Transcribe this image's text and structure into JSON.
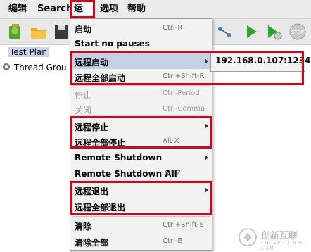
{
  "menubar": {
    "items": [
      "编辑",
      "Search",
      "运行",
      "选项",
      "帮助"
    ],
    "active": "运行"
  },
  "tree": {
    "test_plan": "Test Plan",
    "thread_group": "Thread Grou"
  },
  "run_menu": {
    "items": [
      {
        "label": "启动",
        "shortcut": "Ctrl-R"
      },
      {
        "label": "Start no pauses",
        "shortcut": ""
      },
      {
        "label": "远程启动",
        "shortcut": ""
      },
      {
        "label": "远程全部启动",
        "shortcut": "Ctrl+Shift-R"
      },
      {
        "label": "停止",
        "shortcut": "Ctrl-Period"
      },
      {
        "label": "关闭",
        "shortcut": "Ctrl-Comma"
      },
      {
        "label": "远程停止",
        "shortcut": ""
      },
      {
        "label": "远程全部停止",
        "shortcut": "Alt-X"
      },
      {
        "label": "Remote Shutdown",
        "shortcut": ""
      },
      {
        "label": "Remote Shutdown All",
        "shortcut": "Alt-Z"
      },
      {
        "label": "远程退出",
        "shortcut": ""
      },
      {
        "label": "远程全部退出",
        "shortcut": ""
      },
      {
        "label": "清除",
        "shortcut": "Ctrl+Shift-E"
      },
      {
        "label": "清除全部",
        "shortcut": "Ctrl-E"
      }
    ]
  },
  "submenu": {
    "host": "192.168.0.107:1234"
  },
  "watermark": {
    "text": "创新互联",
    "sub": "CHUANG XIN HU LIAN"
  },
  "colors": {
    "highlight_red": "#d9001b",
    "menu_hover": "#c4d1e4",
    "tree_selected": "#c7d6ec"
  }
}
